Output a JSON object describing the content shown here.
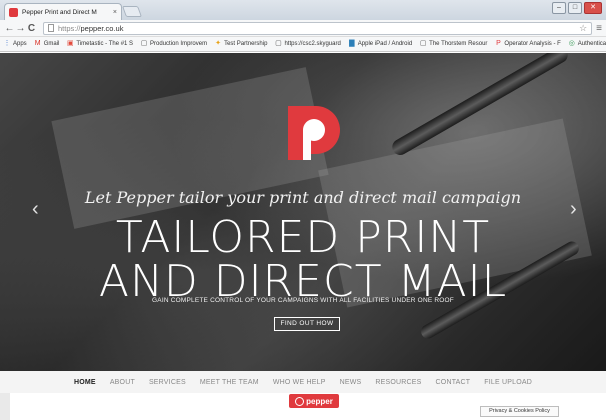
{
  "browser": {
    "tab_title": "Pepper Print and Direct M",
    "tab_close": "×",
    "url_scheme": "https://",
    "url_host": "pepper.co.uk",
    "back": "←",
    "forward": "→",
    "reload": "C",
    "star": "☆",
    "menu": "≡",
    "win_min": "–",
    "win_max": "□",
    "win_close": "✕"
  },
  "bookmarks": [
    {
      "label": "Apps",
      "icon": "apps-icon",
      "color": "#4a7bd0",
      "glyph": "⋮"
    },
    {
      "label": "Gmail",
      "icon": "gmail-icon",
      "color": "#d93025",
      "glyph": "M"
    },
    {
      "label": "Timetastic - The #1 S",
      "icon": "timetastic-icon",
      "color": "#e24a3b",
      "glyph": "▣"
    },
    {
      "label": "Production Improvem",
      "icon": "page-icon",
      "color": "#555555",
      "glyph": "▢"
    },
    {
      "label": "Test Partnership",
      "icon": "test-partnership-icon",
      "color": "#e8a317",
      "glyph": "✦"
    },
    {
      "label": "https://csc2.skyguard",
      "icon": "page-icon",
      "color": "#555555",
      "glyph": "▢"
    },
    {
      "label": "Apple iPad / Android",
      "icon": "app-icon",
      "color": "#2c7fb8",
      "glyph": "▇"
    },
    {
      "label": "The Thorstem Resour",
      "icon": "page-icon",
      "color": "#555555",
      "glyph": "▢"
    },
    {
      "label": "Operator Analysis - F",
      "icon": "pepper-icon",
      "color": "#e03a3e",
      "glyph": "P"
    },
    {
      "label": "Authentication - New",
      "icon": "auth-icon",
      "color": "#3b9c5a",
      "glyph": "◎"
    }
  ],
  "hero": {
    "tagline": "Let Pepper tailor your print and direct mail campaign",
    "headline_1": "TAILORED PRINT",
    "headline_2": "AND DIRECT MAIL",
    "subline": "GAIN COMPLETE CONTROL OF YOUR CAMPAIGNS WITH ALL FACILITIES UNDER ONE ROOF",
    "cta_label": "FIND OUT HOW",
    "prev_arrow": "‹",
    "next_arrow": "›",
    "brand_color": "#e03a3e"
  },
  "nav": {
    "items": [
      "HOME",
      "ABOUT",
      "SERVICES",
      "MEET THE TEAM",
      "WHO WE HELP",
      "NEWS",
      "RESOURCES",
      "CONTACT",
      "FILE UPLOAD"
    ],
    "active": "HOME"
  },
  "footer": {
    "logo_text": "pepper",
    "privacy_label": "Privacy & Cookies Policy"
  }
}
